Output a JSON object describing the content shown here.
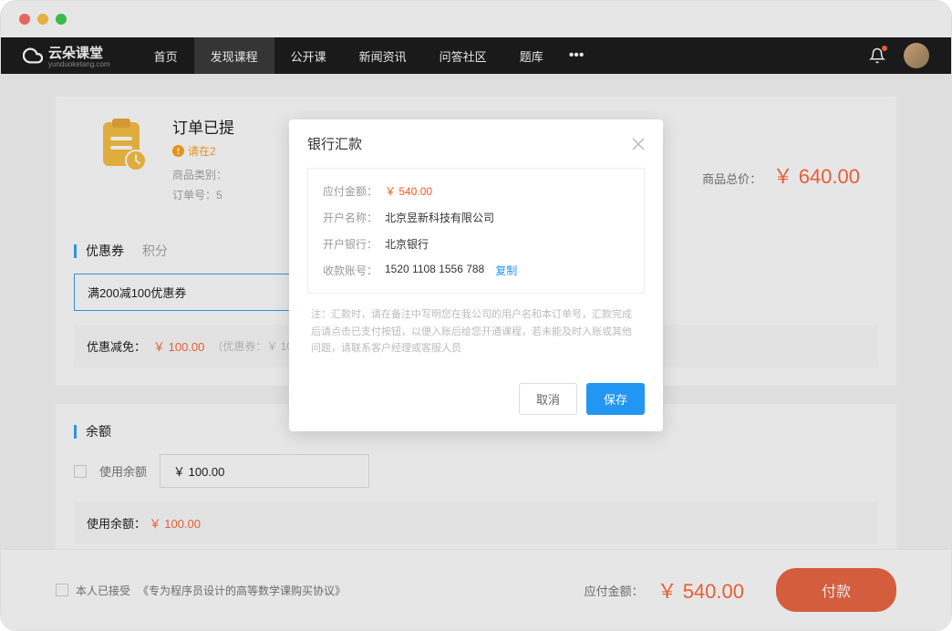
{
  "brand": {
    "name": "云朵课堂",
    "sub": "yunduoketang.com"
  },
  "nav": {
    "items": [
      "首页",
      "发现课程",
      "公开课",
      "新闻资讯",
      "问答社区",
      "题库"
    ],
    "active_index": 1
  },
  "order": {
    "title": "订单已提",
    "warn": "请在2",
    "meta_type_label": "商品类别：",
    "meta_id_label": "订单号：5",
    "total_label": "商品总价：",
    "total_price": "￥ 640.00"
  },
  "coupon": {
    "tab_active": "优惠券",
    "tab_inactive": "积分",
    "selected": "满200减100优惠券",
    "reduce_label": "优惠减免：",
    "reduce_amount": "￥ 100.00",
    "reduce_note": "（优惠券：￥ 10"
  },
  "balance": {
    "title": "余额",
    "checkbox_label": "使用余额",
    "input_value": "￥ 100.00",
    "used_label": "使用余额：",
    "used_amount": "￥ 100.00"
  },
  "agree": {
    "prefix": "本人已接受",
    "link": "《专为程序员设计的高等数学课购买协议》"
  },
  "pay": {
    "label": "应付金额：",
    "amount": "￥ 540.00",
    "button": "付款"
  },
  "modal": {
    "title": "银行汇款",
    "amount_label": "应付金额：",
    "amount_value": "￥ 540.00",
    "account_name_label": "开户名称：",
    "account_name_value": "北京昱新科技有限公司",
    "bank_label": "开户银行：",
    "bank_value": "北京银行",
    "account_no_label": "收款账号：",
    "account_no_value": "1520 1108 1556 788",
    "copy": "复制",
    "note": "注：汇款时，请在备注中写明您在我公司的用户名和本订单号，汇款完成后请点击已支付按钮，以便入账后给您开通课程，若未能及时入账或其他问题，请联系客户经理或客服人员",
    "cancel": "取消",
    "save": "保存"
  }
}
